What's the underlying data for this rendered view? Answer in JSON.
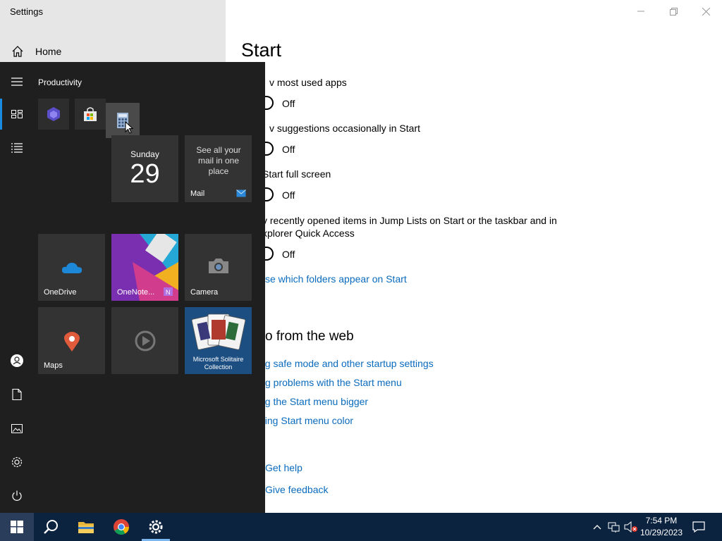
{
  "window": {
    "title": "Settings",
    "home_label": "Home"
  },
  "main": {
    "title": "Start",
    "settings": [
      {
        "label": "v most used apps",
        "state": "Off"
      },
      {
        "label": "v suggestions occasionally in Start",
        "state": "Off"
      },
      {
        "label": "Start full screen",
        "state": "Off"
      },
      {
        "label": "v recently opened items in Jump Lists on Start or the taskbar and in\nxplorer Quick Access",
        "state": "Off"
      }
    ],
    "folders_link": "se which folders appear on Start",
    "web_section_title": "o from the web",
    "web_links": [
      "ng safe mode and other startup settings",
      "g problems with the Start menu",
      "ng the Start menu bigger",
      "ging Start menu color"
    ],
    "get_help": "Get help",
    "give_feedback": "Give feedback"
  },
  "start_menu": {
    "group_title": "Productivity",
    "calendar": {
      "day": "Sunday",
      "date": "29"
    },
    "mail": {
      "text": "See all your mail in one place",
      "label": "Mail"
    },
    "tiles": {
      "onedrive": "OneDrive",
      "onenote": "OneNote...",
      "camera": "Camera",
      "maps": "Maps",
      "solitaire": "Microsoft Solitaire Collection"
    }
  },
  "taskbar": {
    "time": "7:54 PM",
    "date": "10/29/2023"
  },
  "colors": {
    "accent": "#0a6bbd",
    "taskbar": "#0c2340",
    "start_bg": "#1f1f1f"
  }
}
